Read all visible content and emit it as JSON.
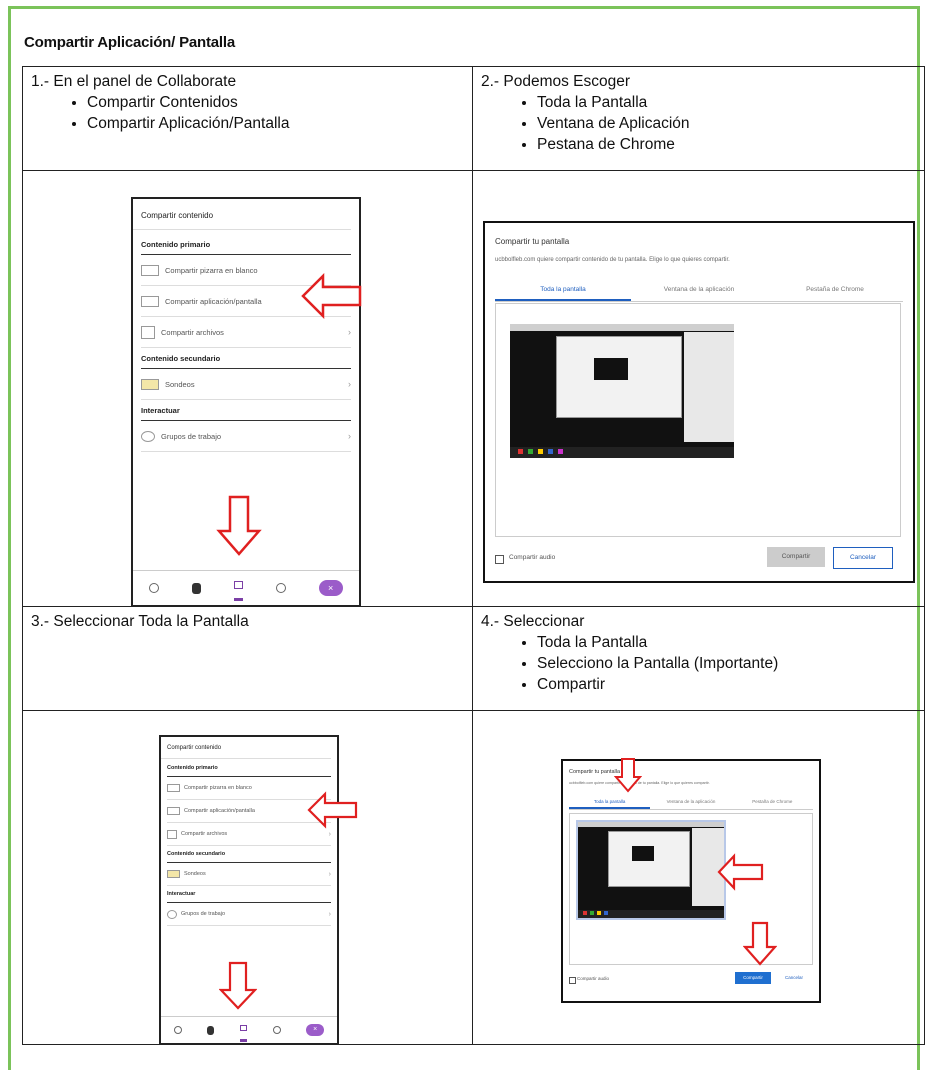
{
  "document": {
    "title": "Compartir Aplicación/ Pantalla"
  },
  "steps": [
    {
      "heading": "1.- En el panel de Collaborate",
      "bullets": [
        "Compartir Contenidos",
        "Compartir Aplicación/Pantalla"
      ]
    },
    {
      "heading": "2.- Podemos Escoger",
      "bullets": [
        "Toda la Pantalla",
        "Ventana de Aplicación",
        "Pestana de Chrome"
      ]
    },
    {
      "heading": "3.- Seleccionar Toda la Pantalla",
      "bullets": []
    },
    {
      "heading": "4.- Seleccionar",
      "bullets": [
        "Toda la Pantalla",
        "Selecciono la Pantalla (Importante)",
        "Compartir"
      ]
    }
  ],
  "panel": {
    "title": "Compartir contenido",
    "section_primary": "Contenido primario",
    "item_whiteboard": "Compartir pizarra en blanco",
    "item_app": "Compartir aplicación/pantalla",
    "item_files": "Compartir archivos",
    "section_secondary": "Contenido secundario",
    "item_polls": "Sondeos",
    "section_interact": "Interactuar",
    "item_groups": "Grupos de trabajo",
    "close_glyph": "×"
  },
  "dialog": {
    "title": "Compartir tu pantalla",
    "subtitle": "ucbbolfleb.com quiere compartir contenido de tu pantalla. Elige lo que quieres compartir.",
    "tab_full": "Toda la pantalla",
    "tab_window": "Ventana de la aplicación",
    "tab_chrome": "Pestaña de Chrome",
    "audio_label": "Compartir audio",
    "share_button": "Compartir",
    "cancel_button": "Cancelar"
  },
  "colors": {
    "frame_green": "#7bc35a",
    "arrow_red": "#e02020",
    "tab_blue": "#1f5fbf",
    "collab_purple": "#9b5cc9"
  }
}
